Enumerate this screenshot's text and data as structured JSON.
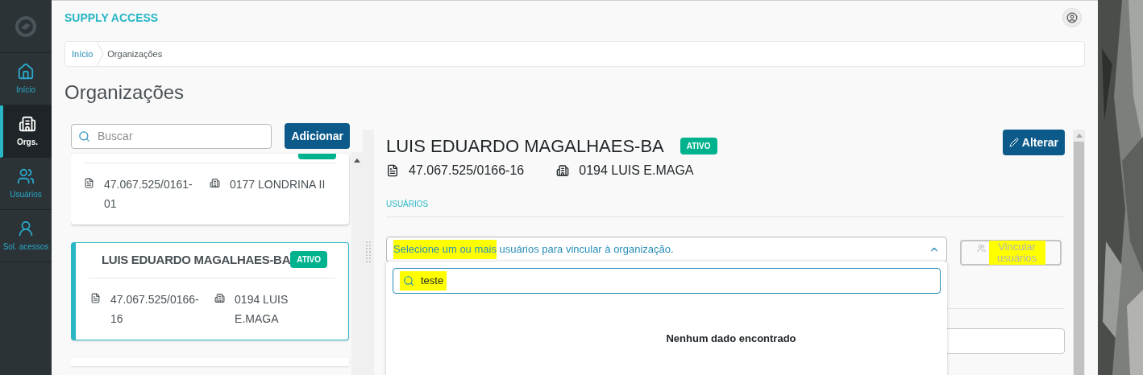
{
  "sidebar": {
    "items": [
      {
        "kind": "home",
        "label": "Início",
        "selected": false
      },
      {
        "kind": "building",
        "label": "Orgs.",
        "selected": true
      },
      {
        "kind": "users",
        "label": "Usuários",
        "selected": false
      },
      {
        "kind": "person",
        "label": "Sol. acessos",
        "selected": false
      }
    ]
  },
  "header": {
    "app_title": "SUPPLY ACCESS"
  },
  "breadcrumb": [
    {
      "label": "Início",
      "selected": false
    },
    {
      "label": "Organizações",
      "selected": true
    }
  ],
  "page_title": "Organizações",
  "org_list": {
    "search": {
      "placeholder": "Buscar"
    },
    "add_button": "Adicionar",
    "cards": [
      {
        "cnpj": "47.067.525/0161-01",
        "code": "0177 LONDRINA II",
        "selected": false
      },
      {
        "title": "LUIS EDUARDO MAGALHAES-BA",
        "status": "ATIVO",
        "cnpj": "47.067.525/0166-16",
        "code": "0194 LUIS E.MAGA",
        "selected": true
      }
    ]
  },
  "detail": {
    "title": "LUIS EDUARDO MAGALHAES-BA",
    "status": "ATIVO",
    "cnpj": "47.067.525/0166-16",
    "code": "0194 LUIS E.MAGA",
    "edit_button": "Alterar",
    "section_label": "USUÁRIOS",
    "user_select": {
      "placeholder": "Selecione um ou mais usuários para vincular à organização.",
      "expanded": true
    },
    "link_button": {
      "label": "Vincular usuários",
      "disabled": true
    },
    "dropdown": {
      "search_value": "teste",
      "empty_message": "Nenhum dado encontrado"
    }
  }
}
